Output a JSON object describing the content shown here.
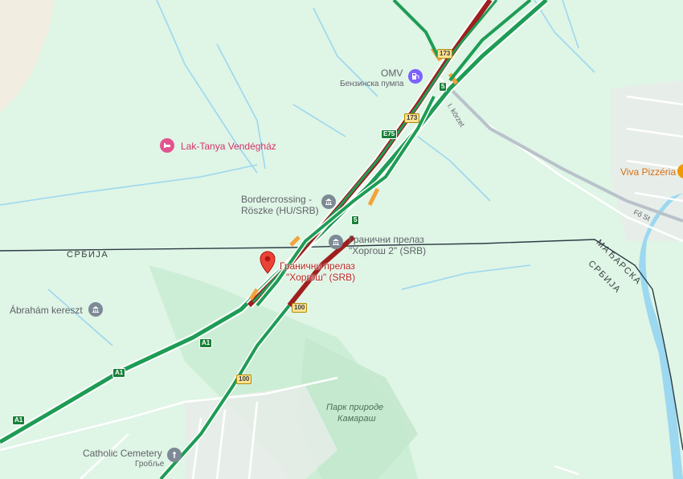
{
  "pois": {
    "omv_name": "OMV",
    "omv_type": "Бензинска пумпа",
    "lak_tanya": "Lak-Tanya Vendégház",
    "bordercrossing_line1": "Bordercrossing -",
    "bordercrossing_line2": "Röszke (HU/SRB)",
    "granicni2_line1": "Гранични прелаз",
    "granicni2_line2": "\"Хоргош 2\" (SRB)",
    "selected_line1": "Гранични прелаз",
    "selected_line2": "\"Хоргош\" (SRB)",
    "abraham": "Ábrahám kereszt",
    "catholic_cemetery": "Catholic Cemetery",
    "catholic_cemetery_sub": "Гробље",
    "viva_pizzeria": "Viva Pizzéria"
  },
  "areas": {
    "park_line1": "Парк природе",
    "park_line2": "Камараш"
  },
  "countries": {
    "serbia_left": "СРБИЈА",
    "hungary": "МАЂАРСКА",
    "serbia_right": "СРБИЈА"
  },
  "streets": {
    "korzet": "I. körzet",
    "fo_st": "Fő St"
  },
  "road_shields": {
    "r173a": "173",
    "r173b": "173",
    "r5a": "5",
    "r5b": "5",
    "e75": "E75",
    "r100a": "100",
    "r100b": "100",
    "a1a": "A1",
    "a1b": "A1",
    "a1c": "A1"
  },
  "colors": {
    "land": "#dff5e6",
    "water": "#9cd8f0",
    "traffic_green": "#1e9c55",
    "traffic_red": "#9e1f1f",
    "traffic_orange": "#f2a33a",
    "border": "#333333"
  }
}
